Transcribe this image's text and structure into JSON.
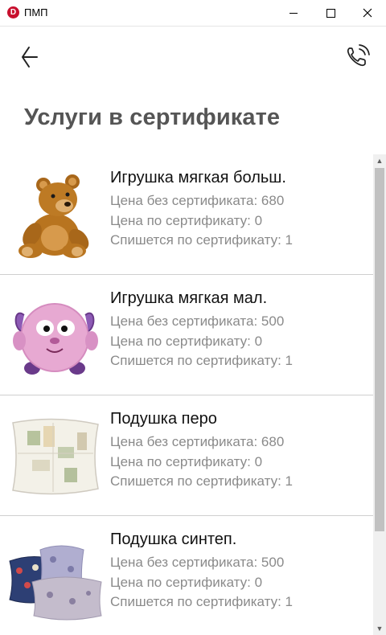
{
  "window": {
    "title": "ПМП",
    "app_icon_letter": "D"
  },
  "appbar": {
    "back_icon": "arrow-left-icon",
    "call_icon": "phone-call-icon"
  },
  "page": {
    "title": "Услуги в сертификате"
  },
  "items": [
    {
      "name": "Игрушка мягкая больш.",
      "price_without": "Цена без сертификата: 680",
      "price_with": "Цена по сертификату: 0",
      "deduct": "Спишется по сертификату: 1",
      "image": "teddy-bear"
    },
    {
      "name": "Игрушка мягкая мал.",
      "price_without": "Цена без сертификата: 500",
      "price_with": "Цена по сертификату: 0",
      "deduct": "Спишется по сертификату: 1",
      "image": "plush-sheep"
    },
    {
      "name": "Подушка перо",
      "price_without": "Цена без сертификата: 680",
      "price_with": "Цена по сертификату: 0",
      "deduct": "Спишется по сертификату: 1",
      "image": "feather-pillow"
    },
    {
      "name": "Подушка синтеп.",
      "price_without": "Цена без сертификата: 500",
      "price_with": "Цена по сертификату: 0",
      "deduct": "Спишется по сертификату: 1",
      "image": "synthetic-pillows"
    }
  ],
  "colors": {
    "title": "#555555",
    "secondary_text": "#8a8a8a",
    "divider": "#cfcfcf"
  }
}
